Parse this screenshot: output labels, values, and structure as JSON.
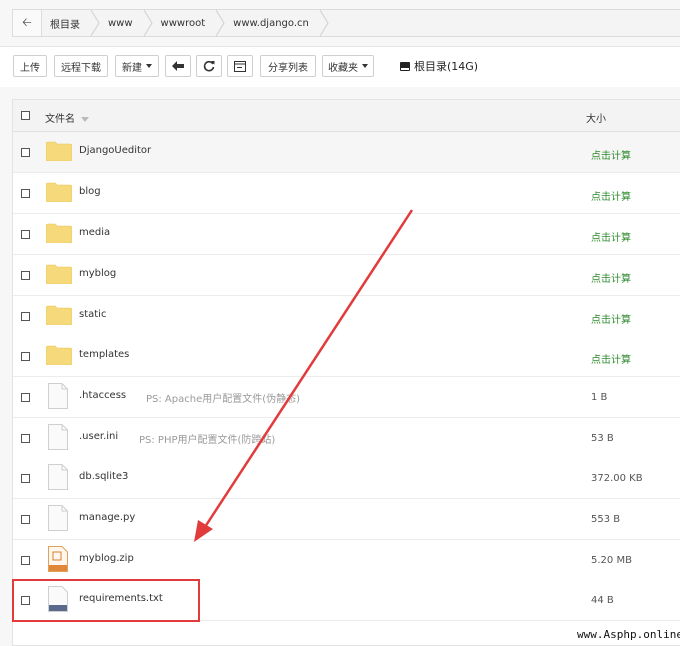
{
  "breadcrumb": {
    "items": [
      "根目录",
      "www",
      "wwwroot",
      "www.django.cn"
    ]
  },
  "toolbar": {
    "upload": "上传",
    "remote_download": "远程下载",
    "new": "新建",
    "share_list": "分享列表",
    "favorites": "收藏夹",
    "disk": "根目录(14G)"
  },
  "table": {
    "col_name": "文件名",
    "col_size": "大小",
    "rows": [
      {
        "name": "DjangoUeditor",
        "size": "点击计算",
        "ps": ""
      },
      {
        "name": "blog",
        "size": "点击计算",
        "ps": ""
      },
      {
        "name": "media",
        "size": "点击计算",
        "ps": ""
      },
      {
        "name": "myblog",
        "size": "点击计算",
        "ps": ""
      },
      {
        "name": "static",
        "size": "点击计算",
        "ps": ""
      },
      {
        "name": "templates",
        "size": "点击计算",
        "ps": ""
      },
      {
        "name": ".htaccess",
        "size": "1 B",
        "ps": "PS: Apache用户配置文件(伪静态)"
      },
      {
        "name": ".user.ini",
        "size": "53 B",
        "ps": "PS: PHP用户配置文件(防跨站)"
      },
      {
        "name": "db.sqlite3",
        "size": "372.00 KB",
        "ps": ""
      },
      {
        "name": "manage.py",
        "size": "553 B",
        "ps": ""
      },
      {
        "name": "myblog.zip",
        "size": "5.20 MB",
        "ps": ""
      },
      {
        "name": "requirements.txt",
        "size": "44 B",
        "ps": ""
      }
    ]
  },
  "watermark": "www.Asphp.online",
  "colors": {
    "folder": "#f5d97a",
    "size_link": "#2e8b2e",
    "highlight": "#e23b3b"
  }
}
